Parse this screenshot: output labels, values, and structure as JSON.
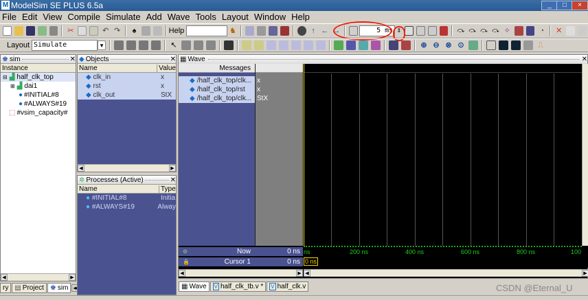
{
  "window": {
    "title": "ModelSim SE PLUS 6.5a",
    "app_icon_letter": "M",
    "buttons": [
      "_",
      "□",
      "×"
    ]
  },
  "menu": [
    "File",
    "Edit",
    "View",
    "Compile",
    "Simulate",
    "Add",
    "Wave",
    "Tools",
    "Layout",
    "Window",
    "Help"
  ],
  "toolbar1": {
    "help_label": "Help",
    "help_value": "",
    "run_length": "5 ms"
  },
  "toolbar2": {
    "layout_label": "Layout",
    "layout_value": "Simulate"
  },
  "sim_panel": {
    "title": "sim",
    "col_instance": "Instance",
    "items": [
      {
        "label": "half_clk_top",
        "selected": true
      },
      {
        "label": "dai1",
        "selected": false
      },
      {
        "label": "#INITIAL#8",
        "selected": false
      },
      {
        "label": "#ALWAYS#19",
        "selected": false
      },
      {
        "label": "#vsim_capacity#",
        "selected": false
      }
    ],
    "tabs": [
      "ry",
      "Project",
      "sim"
    ]
  },
  "objects_panel": {
    "title": "Objects",
    "col_name": "Name",
    "col_value": "Value",
    "rows": [
      {
        "name": "clk_in",
        "value": "x"
      },
      {
        "name": "rst",
        "value": "x"
      },
      {
        "name": "clk_out",
        "value": "StX"
      }
    ]
  },
  "processes_panel": {
    "title": "Processes (Active)",
    "col_name": "Name",
    "col_type": "Type",
    "rows": [
      {
        "name": "#INITIAL#8",
        "type": "Initia"
      },
      {
        "name": "#ALWAYS#19",
        "type": "Alway"
      }
    ]
  },
  "wave_panel": {
    "title": "Wave",
    "messages_header": "Messages",
    "signals": [
      {
        "name": "/half_clk_top/clk...",
        "value": "x"
      },
      {
        "name": "/half_clk_top/rst",
        "value": "x"
      },
      {
        "name": "/half_clk_top/clk...",
        "value": "StX"
      }
    ],
    "now_label": "Now",
    "now_value": "0 ns",
    "cursor_label": "Cursor 1",
    "cursor_value": "0 ns",
    "cursor_marker": "0 ns",
    "timeline_labels": [
      "ns",
      "200 ns",
      "400 ns",
      "600 ns",
      "800 ns",
      "100"
    ],
    "tabs": [
      "Wave",
      "half_clk_tb.v *",
      "half_clk.v"
    ]
  },
  "watermark": "CSDN @Eternal_U"
}
